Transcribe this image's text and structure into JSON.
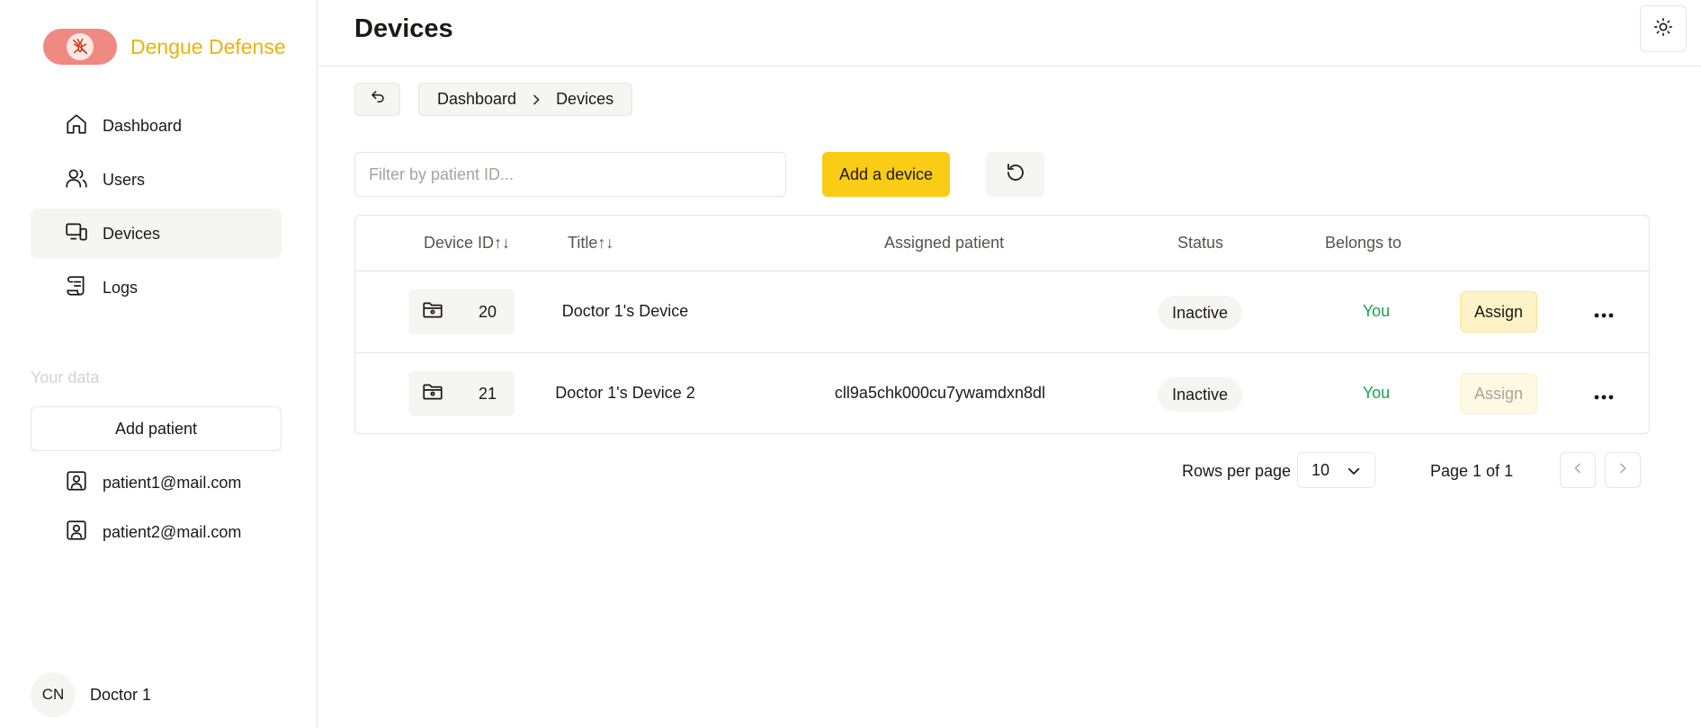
{
  "app": {
    "name": "Dengue Defense",
    "accent": "#eab308",
    "logo_bg": "#ef8a82"
  },
  "sidebar": {
    "items": [
      {
        "label": "Dashboard",
        "icon": "home-icon"
      },
      {
        "label": "Users",
        "icon": "users-icon"
      },
      {
        "label": "Devices",
        "icon": "devices-icon",
        "active": true
      },
      {
        "label": "Logs",
        "icon": "scroll-icon"
      }
    ],
    "section_title": "Your data",
    "add_patient_label": "Add patient",
    "patients": [
      "patient1@mail.com",
      "patient2@mail.com"
    ],
    "user": {
      "initials": "CN",
      "name": "Doctor 1"
    }
  },
  "header": {
    "title": "Devices",
    "theme_icon": "sun-icon"
  },
  "breadcrumb": {
    "items": [
      "Dashboard",
      "Devices"
    ]
  },
  "toolbar": {
    "filter_placeholder": "Filter by patient ID...",
    "filter_value": "",
    "add_label": "Add a device",
    "add_color": "#facc15"
  },
  "table": {
    "columns": {
      "device_id": "Device ID",
      "title": "Title",
      "assigned_patient": "Assigned patient",
      "status": "Status",
      "belongs_to": "Belongs to"
    },
    "rows": [
      {
        "device_id": "20",
        "title": "Doctor 1's Device",
        "assigned_patient": "",
        "status": "Inactive",
        "belongs_to": "You",
        "action": "Assign",
        "action_enabled": true
      },
      {
        "device_id": "21",
        "title": "Doctor 1's Device 2",
        "assigned_patient": "cll9a5chk000cu7ywamdxn8dl",
        "status": "Inactive",
        "belongs_to": "You",
        "action": "Assign",
        "action_enabled": false
      }
    ]
  },
  "pagination": {
    "rows_per_page_label": "Rows per page",
    "rows_per_page": "10",
    "page_label": "Page 1 of 1"
  }
}
